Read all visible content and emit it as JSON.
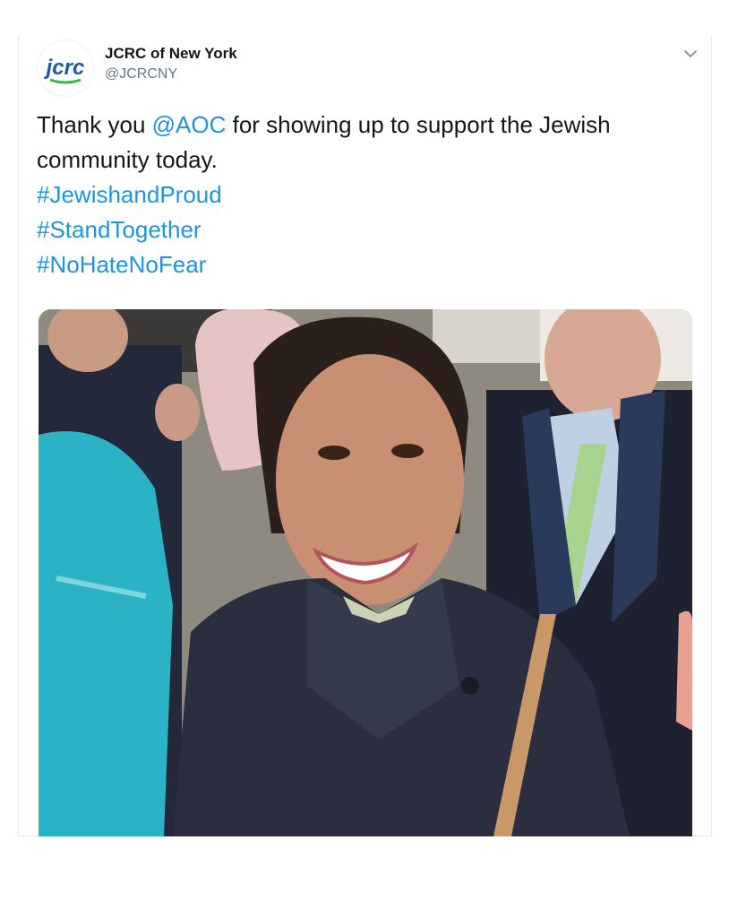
{
  "tweet": {
    "author": {
      "display_name": "JCRC of New York",
      "handle": "@JCRCNY",
      "logo_text": "jcrc"
    },
    "menu_icon": "chevron-down-icon",
    "text": {
      "line1_pre": "Thank you ",
      "mention": "@AOC",
      "line1_post": " for showing up to support the Jewish community today.",
      "hashtags": [
        "#JewishandProud",
        "#StandTogether",
        "#NoHateNoFear"
      ]
    }
  },
  "colors": {
    "link": "#1b95e0",
    "text": "#14171a",
    "secondary": "#657786",
    "logo_blue": "#1d5aa8",
    "logo_green": "#39b54a"
  }
}
